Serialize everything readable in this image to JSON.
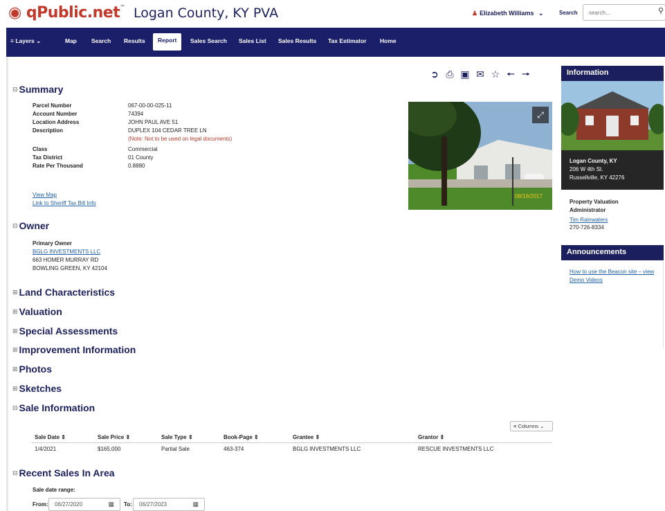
{
  "header": {
    "logo_text": "qPublic.net",
    "logo_tm": "™",
    "county_title": "Logan County, KY PVA",
    "user_name": "Elizabeth Williams",
    "search_label": "Search",
    "search_placeholder": "search..."
  },
  "nav": {
    "items": [
      {
        "label": "≡ Layers ⌄"
      },
      {
        "label": "Map"
      },
      {
        "label": "Search"
      },
      {
        "label": "Results"
      },
      {
        "label": "Report"
      },
      {
        "label": "Sales Search"
      },
      {
        "label": "Sales List"
      },
      {
        "label": "Sales Results"
      },
      {
        "label": "Tax Estimator"
      },
      {
        "label": "Home"
      }
    ],
    "active": "Report"
  },
  "toolbar": {
    "icons": [
      "share-icon",
      "print-icon",
      "image-icon",
      "email-icon",
      "star-icon",
      "arrow-left-icon",
      "arrow-right-icon"
    ]
  },
  "summary": {
    "title": "Summary",
    "rows": [
      {
        "label": "Parcel Number",
        "value": "067-00-00-025-11"
      },
      {
        "label": "Account Number",
        "value": "74394"
      },
      {
        "label": "Location Address",
        "value": "JOHN PAUL AVE 51"
      },
      {
        "label": "Description",
        "value": "DUPLEX 104 CEDAR TREE LN"
      }
    ],
    "note": "(Note: Not to be used on legal documents)",
    "rows2": [
      {
        "label": "Class",
        "value": "Commercial"
      },
      {
        "label": "Tax District",
        "value": "01 County"
      },
      {
        "label": "Rate Per Thousand",
        "value": "0.8880"
      }
    ],
    "view_map": "View Map",
    "sheriff_link": "Link to Sheriff Tax Bill Info",
    "photo_date": "08/16/2017"
  },
  "owner": {
    "title": "Owner",
    "primary_label": "Primary Owner",
    "name": "BGLG INVESTMENTS LLC",
    "address1": "663 HOMER MURRAY RD",
    "address2": "BOWLING GREEN, KY 42104"
  },
  "sections": [
    "Land Characteristics",
    "Valuation",
    "Special Assessments",
    "Improvement Information",
    "Photos",
    "Sketches"
  ],
  "sale": {
    "title": "Sale Information",
    "columns_button": "≡ Columns ⌄",
    "headers": [
      "Sale Date ⇕",
      "Sale Price ⇕",
      "Sale Type ⇕",
      "Book-Page ⇕",
      "Grantee ⇕",
      "Grantor ⇕"
    ],
    "rows": [
      [
        "1/4/2021",
        "$165,000",
        "Partial Sale",
        "463-374",
        "BGLG INVESTMENTS LLC",
        "RESCUE INVESTMENTS LLC"
      ]
    ]
  },
  "recent": {
    "title": "Recent Sales In Area",
    "range_label": "Sale date range:",
    "from_label": "From:",
    "from_value": "06/27/2020",
    "to_label": "To:",
    "to_value": "06/27/2023"
  },
  "info_panel": {
    "title": "Information",
    "addr1": "Logan County, KY",
    "addr2": "206 W 4th St.",
    "addr3": "Russellville, KY 42276",
    "role1": "Property Valuation",
    "role2": "Administrator",
    "contact": "Tim Rainwaters",
    "phone": "270-726-8334"
  },
  "announcements": {
    "title": "Announcements",
    "link1": "How to use the Beacon site – view",
    "link2": "Demo Videos"
  },
  "toggles": {
    "expanded": "⊟",
    "collapsed": "⊞"
  }
}
